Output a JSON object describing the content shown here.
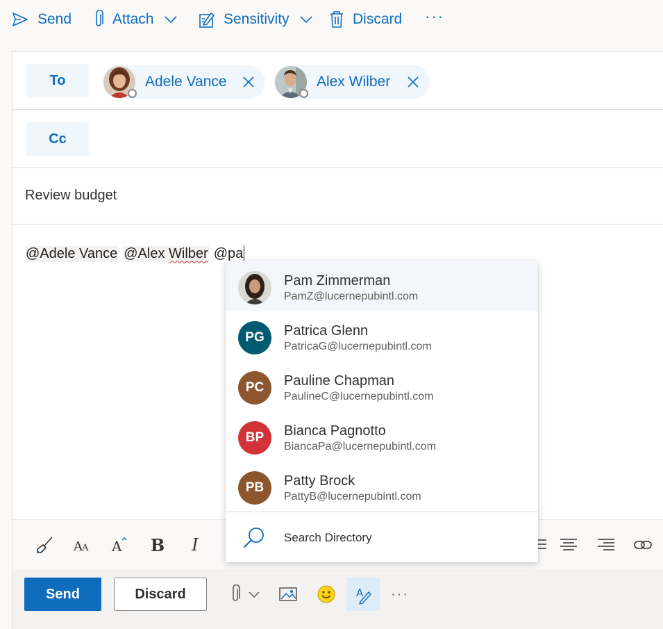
{
  "toolbar": {
    "send_label": "Send",
    "attach_label": "Attach",
    "sensitivity_label": "Sensitivity",
    "discard_label": "Discard",
    "more_label": "···"
  },
  "to": {
    "label": "To",
    "recipients": [
      {
        "name": "Adele Vance",
        "status": "offline"
      },
      {
        "name": "Alex Wilber",
        "status": "offline"
      }
    ]
  },
  "cc": {
    "label": "Cc"
  },
  "subject": "Review budget",
  "body": {
    "mentions": [
      "@Adele Vance",
      "@Alex Wilber"
    ],
    "mention_2_prefix": "@Alex ",
    "mention_2_misspelled": "Wilber",
    "typed": "@pa"
  },
  "suggestions": [
    {
      "name": "Pam Zimmerman",
      "email": "PamZ@lucernepubintl.com",
      "initials": "",
      "color": "#5c4a44",
      "photo": true
    },
    {
      "name": "Patrica Glenn",
      "email": "PatricaG@lucernepubintl.com",
      "initials": "PG",
      "color": "#005b70"
    },
    {
      "name": "Pauline Chapman",
      "email": "PaulineC@lucernepubintl.com",
      "initials": "PC",
      "color": "#8e562e"
    },
    {
      "name": "Bianca Pagnotto",
      "email": "BiancaPa@lucernepubintl.com",
      "initials": "BP",
      "color": "#d13438"
    },
    {
      "name": "Patty Brock",
      "email": "PattyB@lucernepubintl.com",
      "initials": "PB",
      "color": "#8e562e"
    }
  ],
  "search_directory_label": "Search Directory",
  "actions": {
    "send_label": "Send",
    "discard_label": "Discard",
    "more_label": "···"
  },
  "colors": {
    "accent": "#0f6cbd",
    "chip_bg": "#eff6fc",
    "editor_active_bg": "#deecf9"
  }
}
